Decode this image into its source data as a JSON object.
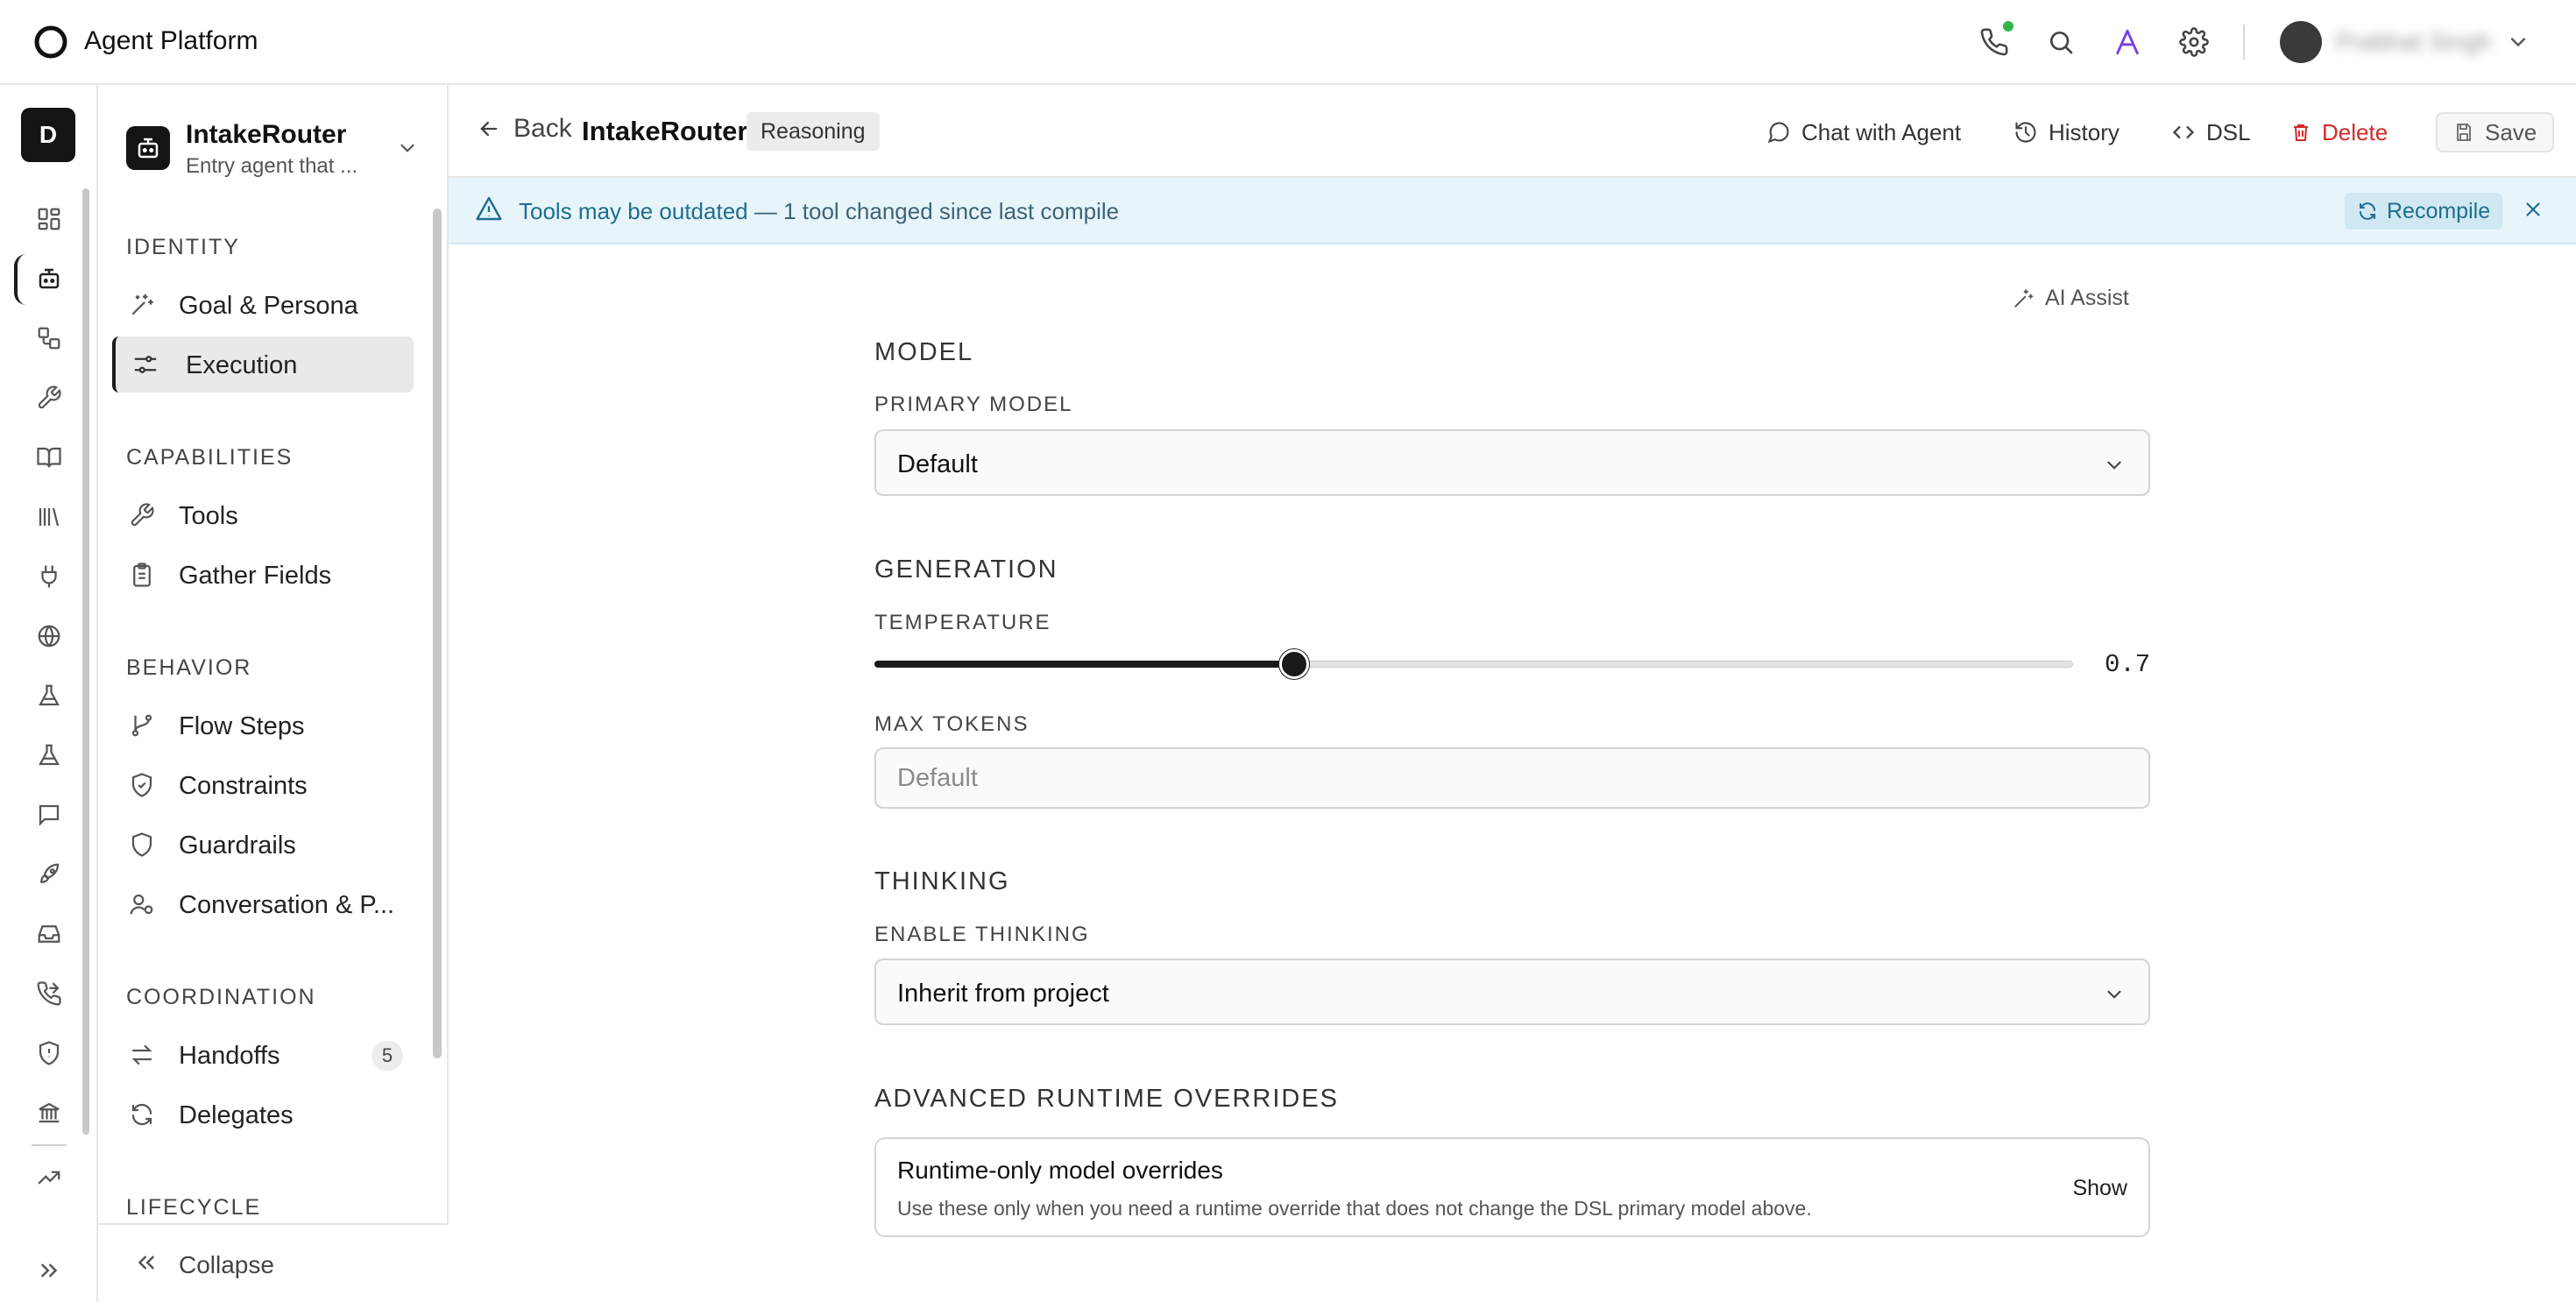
{
  "app": {
    "title": "Agent Platform"
  },
  "header": {
    "user_name": "Prabhat Singh",
    "icons": [
      "phone-icon",
      "search-icon",
      "assistant-a-icon",
      "gear-icon"
    ]
  },
  "rail": {
    "workspace_initial": "D",
    "icons": [
      "dashboard-icon",
      "bot-icon",
      "workflow-icon",
      "wrench-icon",
      "book-icon",
      "library-icon",
      "plug-icon",
      "globe-icon",
      "flask-icon",
      "flask-icon",
      "message-icon",
      "rocket-icon",
      "inbox-icon",
      "phone-forward-icon",
      "shield-icon",
      "bank-icon",
      "trend-icon",
      "expand-icon"
    ]
  },
  "agent": {
    "name": "IntakeRouter",
    "description": "Entry agent that ..."
  },
  "nav": {
    "groups": {
      "identity": "IDENTITY",
      "capabilities": "CAPABILITIES",
      "behavior": "BEHAVIOR",
      "coordination": "COORDINATION",
      "lifecycle": "LIFECYCLE"
    },
    "items": {
      "goal": "Goal & Persona",
      "execution": "Execution",
      "tools": "Tools",
      "gather": "Gather Fields",
      "flow": "Flow Steps",
      "constraints": "Constraints",
      "guardrails": "Guardrails",
      "conversation": "Conversation & P...",
      "handoffs": "Handoffs",
      "handoffs_count": "5",
      "delegates": "Delegates"
    },
    "collapse": "Collapse"
  },
  "page": {
    "back": "Back",
    "title": "IntakeRouter",
    "badge": "Reasoning",
    "actions": {
      "chat": "Chat with Agent",
      "history": "History",
      "dsl": "DSL",
      "delete": "Delete",
      "save": "Save"
    }
  },
  "banner": {
    "strong": "Tools may be outdated",
    "rest": " — 1 tool changed since last compile",
    "recompile": "Recompile"
  },
  "form": {
    "ai_assist": "AI Assist",
    "model": {
      "section": "MODEL",
      "primary_label": "PRIMARY MODEL",
      "primary_value": "Default"
    },
    "generation": {
      "section": "GENERATION",
      "temperature_label": "TEMPERATURE",
      "temperature_value": "0.7",
      "temperature_fraction": 0.35,
      "max_tokens_label": "MAX TOKENS",
      "max_tokens_placeholder": "Default"
    },
    "thinking": {
      "section": "THINKING",
      "enable_label": "ENABLE THINKING",
      "enable_value": "Inherit from project"
    },
    "advanced": {
      "section": "ADVANCED RUNTIME OVERRIDES",
      "card_title": "Runtime-only model overrides",
      "card_desc": "Use these only when you need a runtime override that does not change the DSL primary model above.",
      "show": "Show"
    }
  }
}
